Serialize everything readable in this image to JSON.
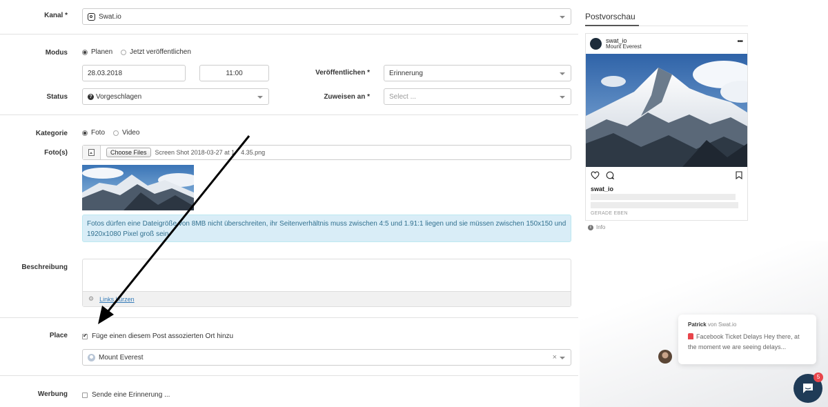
{
  "form": {
    "kanal": {
      "label": "Kanal *",
      "value": "Swat.io"
    },
    "modus": {
      "label": "Modus",
      "options": [
        "Planen",
        "Jetzt veröffentlichen"
      ],
      "selected": "Planen"
    },
    "date": {
      "value": "28.03.2018"
    },
    "time": {
      "value": "11:00"
    },
    "veroeffentlichen": {
      "label": "Veröffentlichen *",
      "value": "Erinnerung"
    },
    "status": {
      "label": "Status",
      "value": "Vorgeschlagen"
    },
    "zuweisen": {
      "label": "Zuweisen an *",
      "placeholder": "Select ..."
    },
    "kategorie": {
      "label": "Kategorie",
      "options": [
        "Foto",
        "Video"
      ],
      "selected": "Foto"
    },
    "fotos": {
      "label": "Foto(s)",
      "button": "Choose Files",
      "filename": "Screen Shot 2018-03-27 at 1  4.35.png"
    },
    "photo_info": "Fotos dürfen eine Dateigröße von 8MB nicht überschreiten, ihr Seitenverhältnis muss zwischen 4:5 und 1.91:1 liegen und sie müssen zwischen 150x150 und 1920x1080 Pixel groß sein.",
    "beschreibung": {
      "label": "Beschreibung",
      "shorten_link": "Links kürzen"
    },
    "place": {
      "label": "Place",
      "checkbox": "Füge einen diesem Post assozierten Ort hinzu",
      "checked": true,
      "value": "Mount Everest",
      "clear": "×"
    },
    "werbung": {
      "label": "Werbung",
      "checkbox": "Sende eine Erinnerung ...",
      "checked": false
    }
  },
  "preview": {
    "title": "Postvorschau",
    "username": "swat_io",
    "location": "Mount Everest",
    "more": "•••",
    "caption_user": "swat_io",
    "time": "GERADE EBEN",
    "info": "Info"
  },
  "chat": {
    "agent": "Patrick",
    "from_suffix": "von Swat.io",
    "message": "Facebook Ticket Delays Hey there, at the moment we are seeing delays...",
    "badge": "5"
  },
  "colors": {
    "info_bg": "#d9edf7",
    "info_text": "#31708f",
    "chat_launcher": "#1f3b57",
    "badge": "#e8454b",
    "link": "#337ab7"
  }
}
